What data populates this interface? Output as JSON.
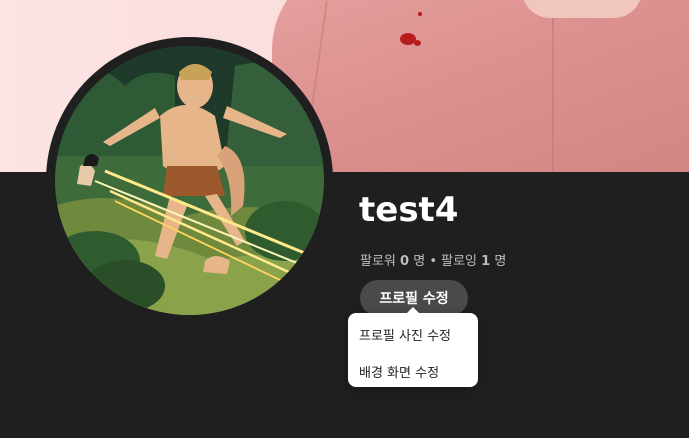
{
  "profile": {
    "name": "test4",
    "followers_label": "팔로워",
    "followers_count": "0",
    "following_label": "팔로잉",
    "following_count": "1",
    "unit": "명",
    "separator": "•"
  },
  "actions": {
    "edit_profile_label": "프로필 수정"
  },
  "menu": {
    "items": [
      {
        "label": "프로필 사진 수정"
      },
      {
        "label": "배경 화면 수정"
      }
    ]
  },
  "colors": {
    "page_background": "#1f1f1f",
    "banner_pink": "#f5cccc",
    "coat_pink": "#dc918f",
    "button_gray": "#4a4a4a",
    "menu_background": "#ffffff"
  }
}
